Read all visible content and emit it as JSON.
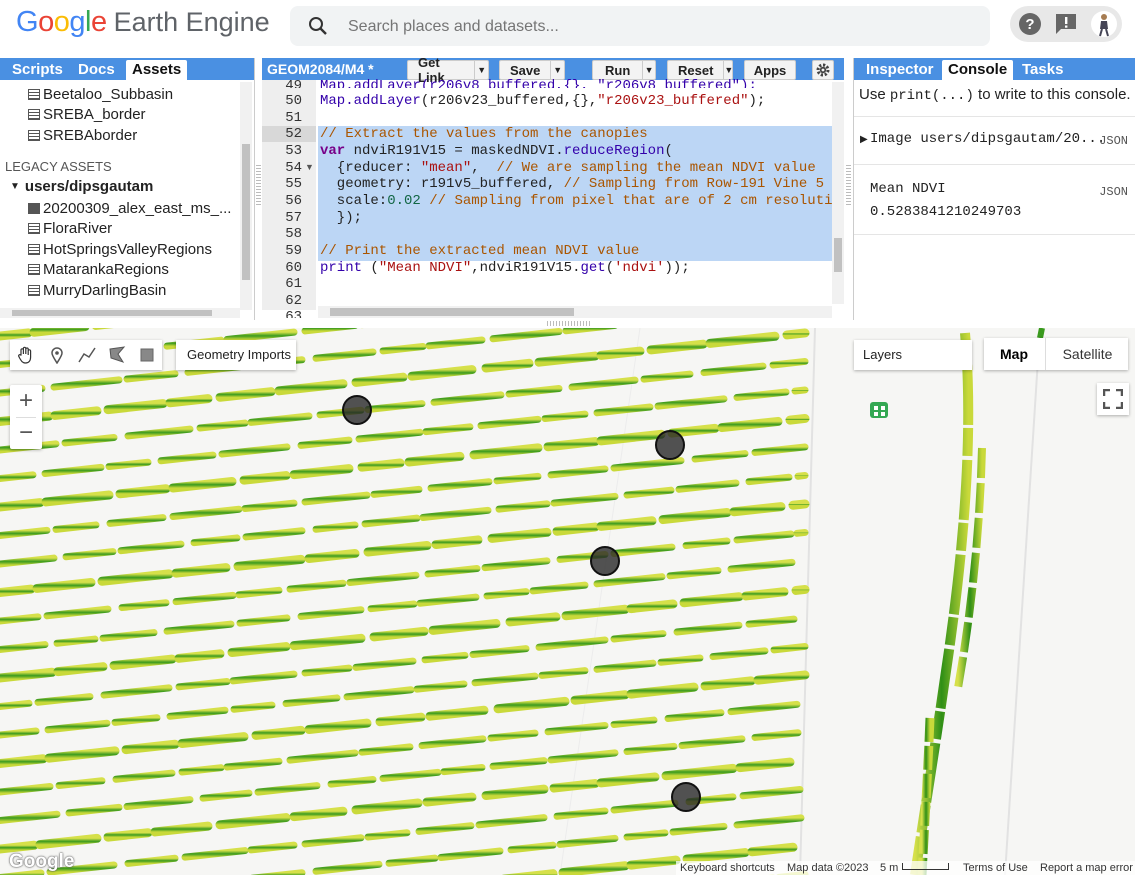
{
  "header": {
    "logo_google": "Google",
    "logo_ee": "Earth Engine",
    "search_placeholder": "Search places and datasets..."
  },
  "left_panel": {
    "tabs": [
      "Scripts",
      "Docs",
      "Assets"
    ],
    "active_tab": "Assets",
    "items": [
      "Beetaloo_Subbasin",
      "SREBA_border",
      "SREBAborder"
    ],
    "legacy_header": "LEGACY ASSETS",
    "user_folder": "users/dipsgautam",
    "user_items": [
      "20200309_alex_east_ms_...",
      "FloraRiver",
      "HotSpringsValleyRegions",
      "MatarankaRegions",
      "MurryDarlingBasin"
    ]
  },
  "editor": {
    "script_name": "GEOM2084/M4 *",
    "buttons": [
      "Get Link",
      "Save",
      "Run",
      "Reset",
      "Apps"
    ],
    "line_numbers": [
      "49",
      "50",
      "51",
      "52",
      "53",
      "54",
      "55",
      "56",
      "57",
      "58",
      "59",
      "60",
      "61",
      "62",
      "63"
    ],
    "lines": {
      "l49": "Map.addLayer(r206v8_buffered,{}, \"r206v8_buffered\");",
      "l50a": "Map.addLayer",
      "l50b": "(r206v23_buffered,{},",
      "l50c": "\"r206v23_buffered\"",
      "l50d": ");",
      "l52": "// Extract the values from the canopies",
      "l53a": "var",
      "l53b": " ndviR191V15 = maskedNDVI.",
      "l53c": "reduceRegion",
      "l53d": "(",
      "l54a": "  {reducer: ",
      "l54b": "\"mean\"",
      "l54c": ",  ",
      "l54d": "// We are sampling the mean NDVI value",
      "l55a": "  geometry: r191v5_buffered, ",
      "l55b": "// Sampling from Row-191 Vine 5",
      "l56a": "  scale:",
      "l56b": "0.02",
      "l56c": " ",
      "l56d": "// Sampling from pixel that are of 2 cm resoluti",
      "l57": "  });",
      "l59": "// Print the extracted mean NDVI value",
      "l60a": "print",
      "l60b": " (",
      "l60c": "\"Mean NDVI\"",
      "l60d": ",ndviR191V15.",
      "l60e": "get",
      "l60f": "(",
      "l60g": "'ndvi'",
      "l60h": "));"
    }
  },
  "right_panel": {
    "tabs": [
      "Inspector",
      "Console",
      "Tasks"
    ],
    "active_tab": "Console",
    "hint_pre": "Use ",
    "hint_code": "print(...)",
    "hint_post": " to write to this console.",
    "entries": [
      {
        "text": "Image users/dipsgautam/20...",
        "badge": "JSON"
      },
      {
        "label": "Mean NDVI",
        "value": "0.5283841210249703",
        "badge": "JSON"
      }
    ]
  },
  "map": {
    "geometry_imports": "Geometry Imports",
    "layers": "Layers",
    "map_type_map": "Map",
    "map_type_satellite": "Satellite",
    "zoom_in": "+",
    "zoom_out": "−",
    "google": "Google",
    "footer": {
      "shortcuts": "Keyboard shortcuts",
      "map_data": "Map data ©2023",
      "scale": "5 m",
      "terms": "Terms of Use",
      "report": "Report a map error"
    }
  },
  "colors": {
    "tab_blue": "#4a90e2",
    "selection": "#bcd6f5",
    "vine_green": "#3a9a1e",
    "vine_yellow": "#d6e04a"
  }
}
